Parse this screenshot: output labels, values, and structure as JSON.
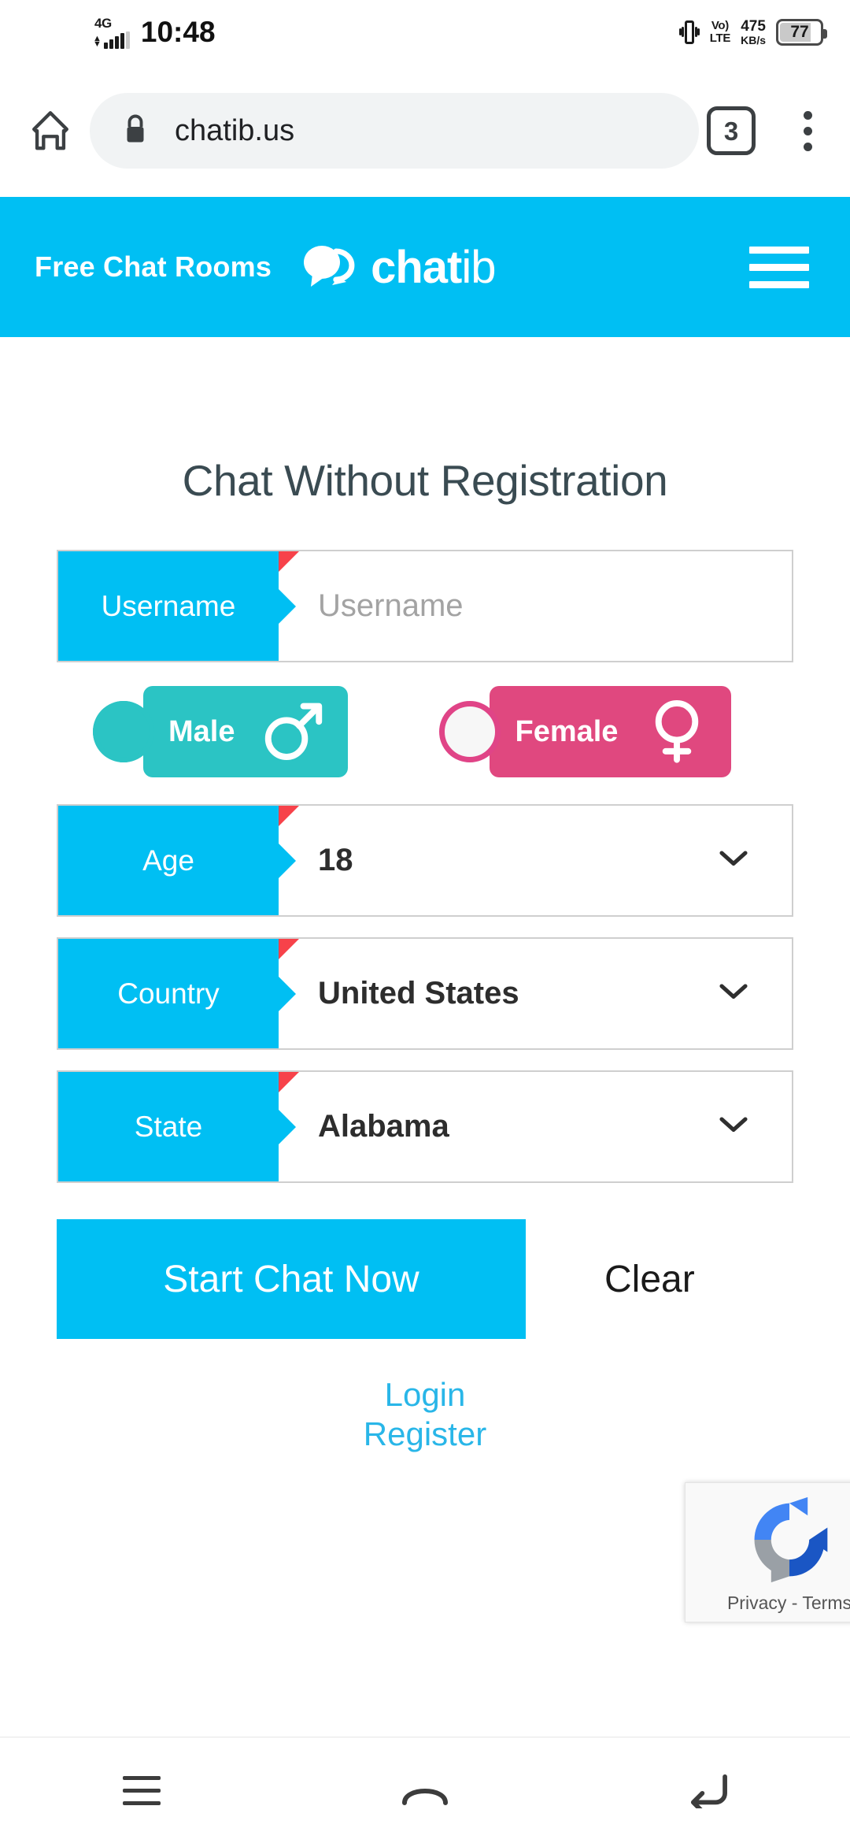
{
  "status_bar": {
    "network_type": "4G",
    "time": "10:48",
    "volte_line1": "Vo)",
    "volte_line2": "LTE",
    "net_speed_value": "475",
    "net_speed_unit": "KB/s",
    "battery_level": "77",
    "vibrate_icon": "vibrate-icon",
    "signal_icon": "signal-bars-icon"
  },
  "browser": {
    "home_icon": "home-icon",
    "lock_icon": "lock-icon",
    "url": "chatib.us",
    "tab_count": "3",
    "menu_icon": "kebab-menu-icon"
  },
  "site_header": {
    "tagline": "Free Chat Rooms",
    "logo_icon": "chat-bubbles-logo",
    "brand_bold": "chat",
    "brand_light": "ib",
    "menu_icon": "hamburger-menu-icon",
    "background_color": "#00bff3"
  },
  "main": {
    "title": "Chat Without Registration",
    "fields": [
      {
        "label": "Username",
        "value": "Username",
        "is_placeholder": true,
        "required": true,
        "kind": "text"
      },
      {
        "label": "Age",
        "value": "18",
        "is_placeholder": false,
        "required": true,
        "kind": "select"
      },
      {
        "label": "Country",
        "value": "United States",
        "is_placeholder": false,
        "required": true,
        "kind": "select"
      },
      {
        "label": "State",
        "value": "Alabama",
        "is_placeholder": false,
        "required": true,
        "kind": "select"
      }
    ],
    "gender": {
      "male": {
        "label": "Male",
        "selected": true,
        "color": "#2bc4c4",
        "icon": "male-gender-icon"
      },
      "female": {
        "label": "Female",
        "selected": false,
        "color": "#e0487f",
        "icon": "female-gender-icon"
      }
    },
    "start_button": "Start Chat Now",
    "clear_button": "Clear",
    "login_link": "Login",
    "register_link": "Register",
    "accent_color": "#00bff3",
    "link_color": "#29b6e8"
  },
  "recaptcha": {
    "icon": "recaptcha-logo",
    "text": "Privacy - Terms"
  },
  "nav_bar": {
    "recents_icon": "recents-icon",
    "home_icon": "home-nav-icon",
    "back_icon": "back-nav-icon"
  }
}
